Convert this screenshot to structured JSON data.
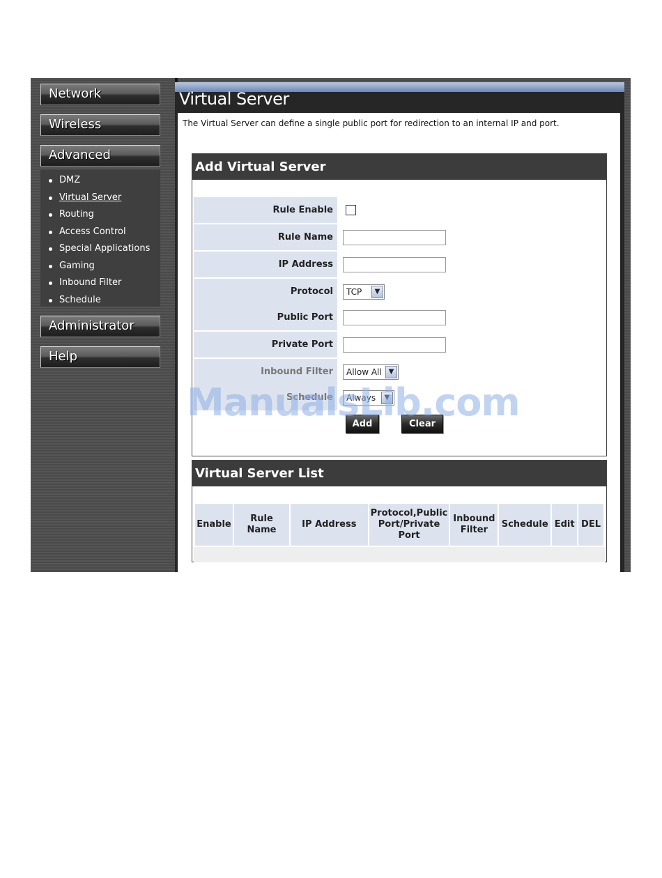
{
  "sidebar": {
    "network": "Network",
    "wireless": "Wireless",
    "advanced": "Advanced",
    "advanced_items": [
      {
        "label": "DMZ"
      },
      {
        "label": "Virtual Server"
      },
      {
        "label": "Routing"
      },
      {
        "label": "Access Control"
      },
      {
        "label": "Special Applications"
      },
      {
        "label": "Gaming"
      },
      {
        "label": "Inbound Filter"
      },
      {
        "label": "Schedule"
      }
    ],
    "administrator": "Administrator",
    "help": "Help"
  },
  "page": {
    "title": "Virtual Server",
    "description": "The Virtual Server can define a single public port for redirection to an internal IP and port."
  },
  "add_panel": {
    "title": "Add Virtual Server",
    "rule_enable_label": "Rule Enable",
    "rule_name_label": "Rule Name",
    "ip_address_label": "IP Address",
    "protocol_label": "Protocol",
    "protocol_value": "TCP",
    "public_port_label": "Public Port",
    "private_port_label": "Private Port",
    "inbound_filter_label": "Inbound Filter",
    "inbound_filter_value": "Allow All",
    "schedule_label": "Schedule",
    "schedule_value": "Always",
    "add_button": "Add",
    "clear_button": "Clear"
  },
  "list_panel": {
    "title": "Virtual Server List",
    "columns": [
      "Enable",
      "Rule Name",
      "IP Address",
      "Protocol,Public Port/Private Port",
      "Inbound Filter",
      "Schedule",
      "Edit",
      "DEL"
    ]
  },
  "watermark": "ManualsLib.com"
}
